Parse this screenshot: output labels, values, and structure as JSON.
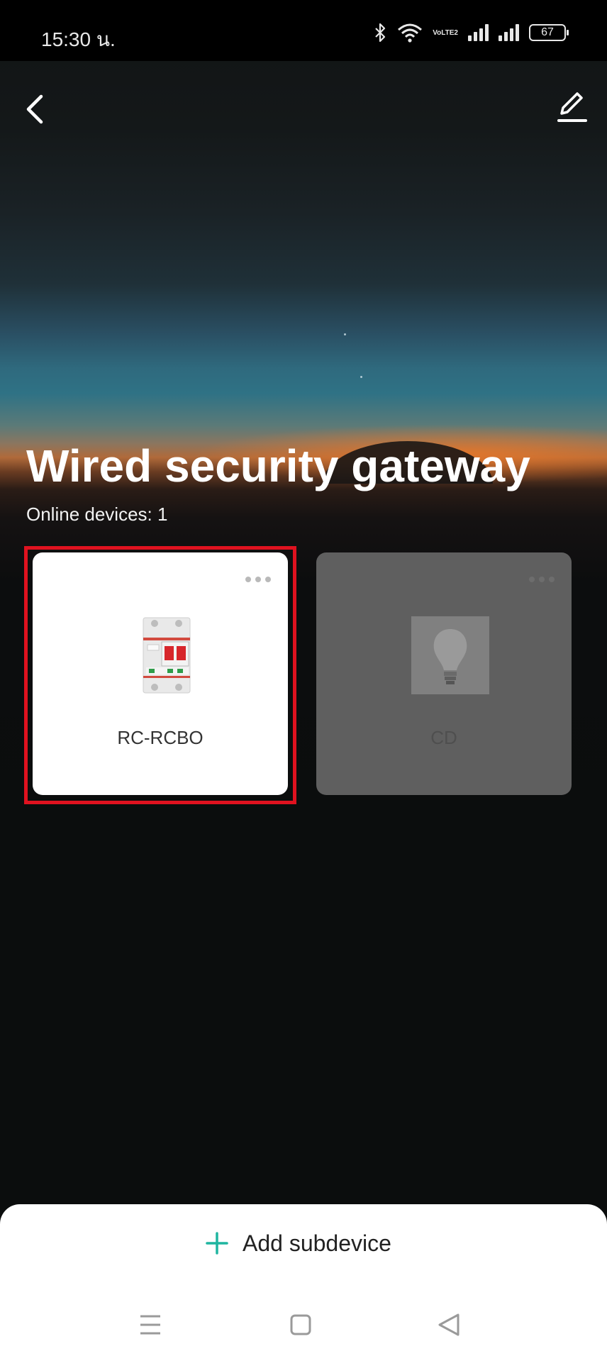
{
  "status_bar": {
    "time": "15:30 น.",
    "network_label": "VoLTE2",
    "battery": "67"
  },
  "header": {
    "back_icon": "chevron-left-icon",
    "edit_icon": "pencil-icon"
  },
  "gateway": {
    "title": "Wired security gateway",
    "online_devices": "Online devices: 1"
  },
  "devices": [
    {
      "name": "RC-RCBO",
      "icon": "circuit-breaker-image",
      "status": "online",
      "highlighted": true
    },
    {
      "name": "CD",
      "icon": "light-bulb-image",
      "status": "offline",
      "highlighted": false
    }
  ],
  "bottom": {
    "add_label": "Add subdevice",
    "accent_color": "#1fb5a0"
  },
  "colors": {
    "highlight": "#e0121f",
    "offline_card": "#5f5f5f"
  }
}
